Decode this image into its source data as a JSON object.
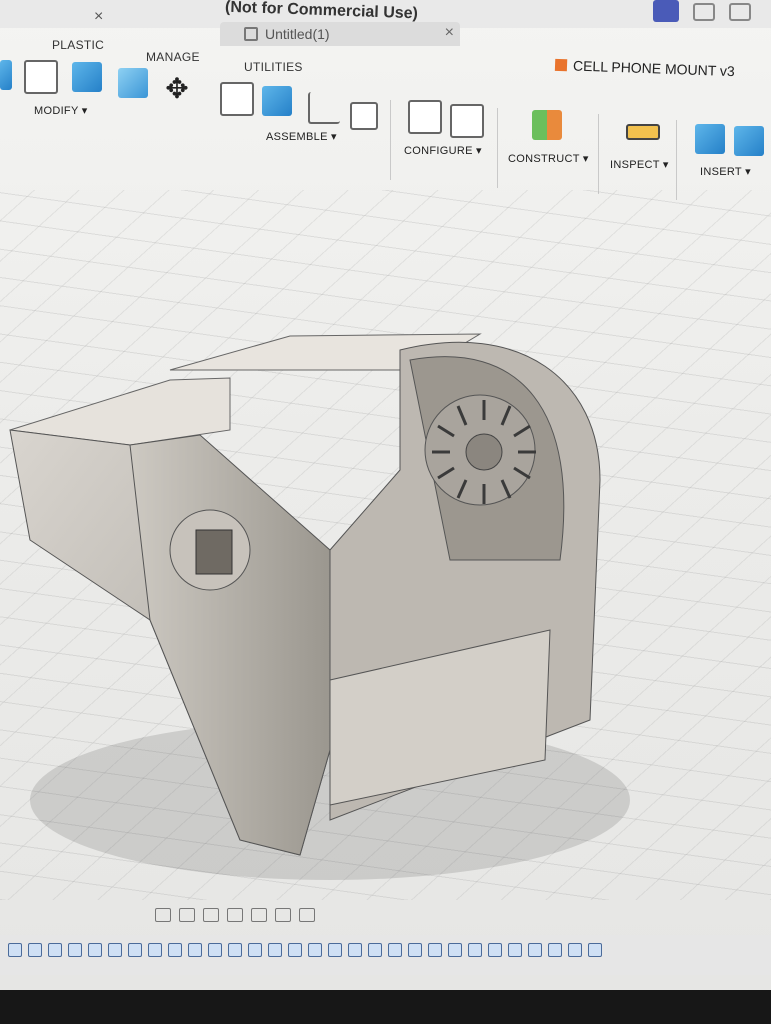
{
  "window": {
    "title": "(Not for Commercial Use)",
    "close_symbol": "×"
  },
  "tab": {
    "name": "Untitled(1)",
    "close_symbol": "×"
  },
  "project": {
    "name": "CELL PHONE MOUNT v3"
  },
  "ribbon": {
    "tabs": [
      "PLASTIC",
      "MANAGE",
      "UTILITIES"
    ],
    "groups": [
      "MODIFY ▾",
      "ASSEMBLE ▾",
      "CONFIGURE ▾",
      "CONSTRUCT ▾",
      "INSPECT ▾",
      "INSERT ▾"
    ]
  },
  "colors": {
    "accent": "#2580c8",
    "brand": "#e9732c"
  },
  "icons": [
    "push-pull-icon",
    "fillet-icon",
    "combine-icon",
    "move-icon",
    "joint-icon",
    "component-icon",
    "table-icon",
    "configure-icon",
    "plane-icon",
    "measure-icon",
    "insert-icon"
  ]
}
